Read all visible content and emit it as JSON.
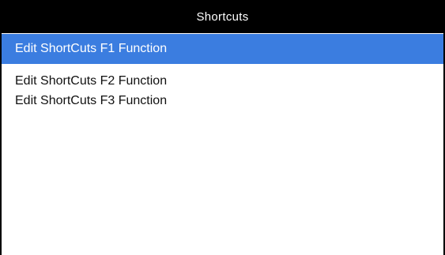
{
  "window": {
    "title": "Shortcuts"
  },
  "menu": {
    "items": [
      {
        "label": "Edit ShortCuts F1 Function",
        "selected": true
      },
      {
        "label": "Edit ShortCuts F2 Function",
        "selected": false
      },
      {
        "label": "Edit ShortCuts F3 Function",
        "selected": false
      }
    ]
  },
  "colors": {
    "titlebar_bg": "#000000",
    "selection": "#3b7de0",
    "background": "#ffffff"
  }
}
